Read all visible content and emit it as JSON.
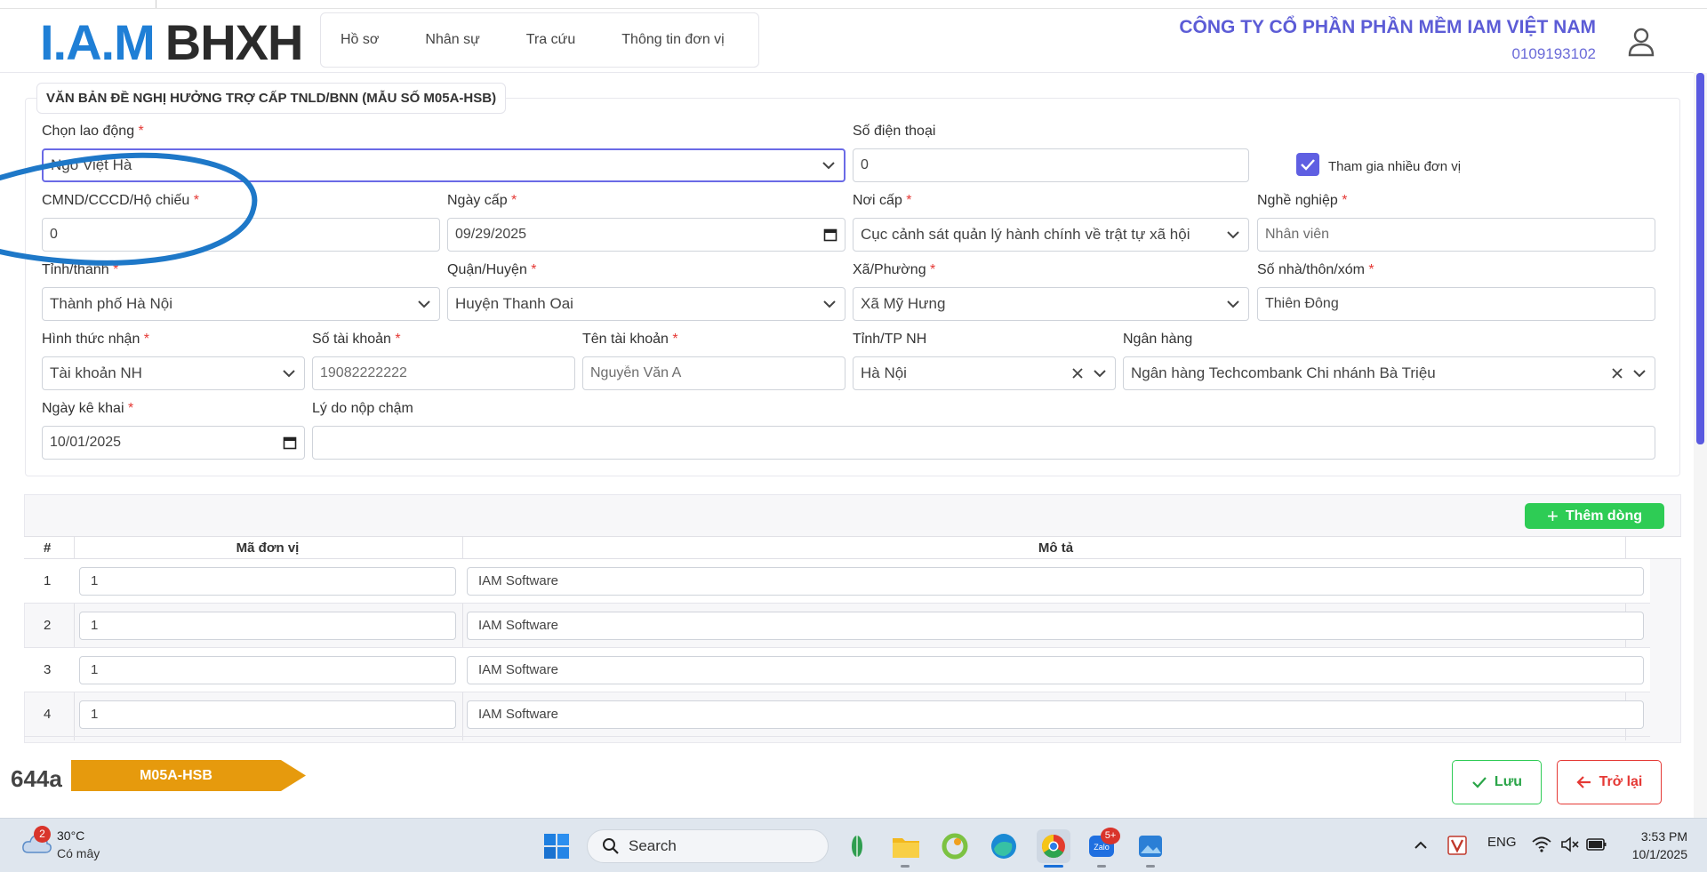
{
  "header": {
    "logo_left": "I.A.M",
    "logo_right": "BHXH",
    "nav": [
      "Hồ sơ",
      "Nhân sự",
      "Tra cứu",
      "Thông tin đơn vị"
    ],
    "company_name": "CÔNG TY CỔ PHẦN PHẦN MỀM IAM VIỆT NAM",
    "company_tax": "0109193102"
  },
  "form": {
    "title": "VĂN BẢN ĐỀ NGHỊ HƯỞNG TRỢ CẤP TNLD/BNN (MẪU SỐ M05A-HSB)",
    "employee_label": "Chọn lao động",
    "employee_value": "Ngô Việt Hà",
    "phone_label": "Số điện thoại",
    "phone_value": "0",
    "multi_unit_label": "Tham gia nhiều đơn vị",
    "multi_unit_checked": true,
    "id_label": "CMND/CCCD/Hộ chiếu",
    "id_value": "0",
    "issue_date_label": "Ngày cấp",
    "issue_date_value": "09/29/2025",
    "issue_place_label": "Nơi cấp",
    "issue_place_value": "Cục cảnh sát quản lý hành chính về trật tự xã hội",
    "job_label": "Nghề nghiệp",
    "job_value": "Nhân viên",
    "province_label": "Tỉnh/thành",
    "province_value": "Thành phố Hà Nội",
    "district_label": "Quận/Huyện",
    "district_value": "Huyện Thanh Oai",
    "ward_label": "Xã/Phường",
    "ward_value": "Xã Mỹ Hưng",
    "address_label": "Số nhà/thôn/xóm",
    "address_value": "Thiên Đông",
    "receive_method_label": "Hình thức nhận",
    "receive_method_value": "Tài khoản NH",
    "account_no_label": "Số tài khoản",
    "account_no_value": "19082222222",
    "account_name_label": "Tên tài khoản",
    "account_name_value": "Nguyễn Văn A",
    "bank_province_label": "Tỉnh/TP NH",
    "bank_province_value": "Hà Nội",
    "bank_label": "Ngân hàng",
    "bank_value": "Ngân hàng Techcombank Chi nhánh Bà Triệu",
    "declare_date_label": "Ngày kê khai",
    "declare_date_value": "10/01/2025",
    "late_reason_label": "Lý do nộp chậm",
    "late_reason_value": ""
  },
  "table": {
    "add_button": "Thêm dòng",
    "headers": [
      "#",
      "Mã đơn vị",
      "Mô tả"
    ],
    "rows": [
      {
        "num": "1",
        "code": "1",
        "desc": "IAM Software"
      },
      {
        "num": "2",
        "code": "1",
        "desc": "IAM Software"
      },
      {
        "num": "3",
        "code": "1",
        "desc": "IAM Software"
      },
      {
        "num": "4",
        "code": "1",
        "desc": "IAM Software"
      }
    ]
  },
  "footer": {
    "code": "644a",
    "form_code": "M05A-HSB",
    "save": "Lưu",
    "back": "Trở lại",
    "tag_color": "#e69a0d"
  },
  "taskbar": {
    "weather_badge": "2",
    "temperature": "30°C",
    "condition": "Có mây",
    "search_placeholder": "Search",
    "zalo_badge": "5+",
    "language": "ENG",
    "time": "3:53 PM",
    "date": "10/1/2025"
  }
}
